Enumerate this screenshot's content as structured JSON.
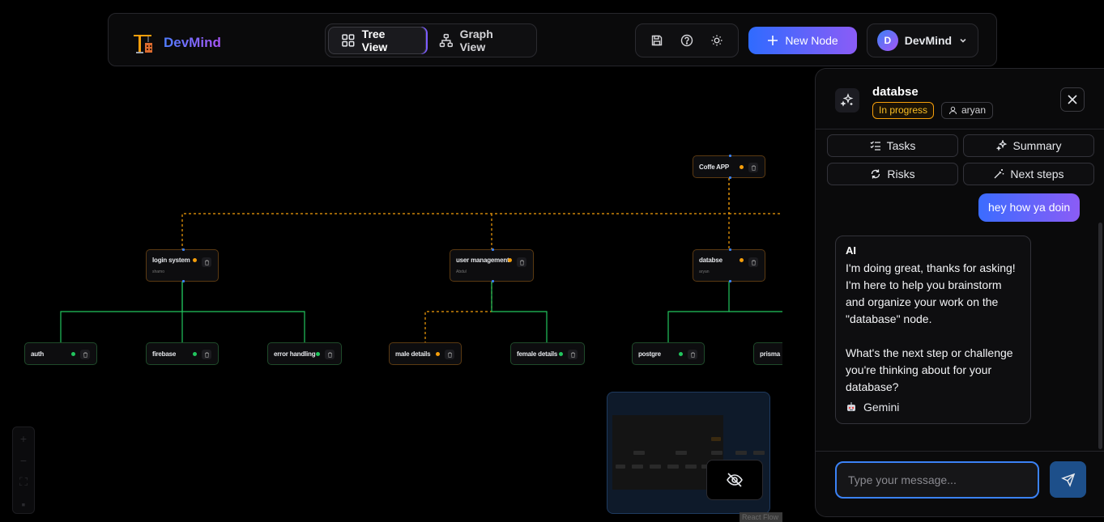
{
  "header": {
    "app_name": "DevMind",
    "views": [
      {
        "label": "Tree View",
        "active": true
      },
      {
        "label": "Graph View",
        "active": false
      }
    ],
    "tools": [
      "save-icon",
      "help-icon",
      "theme-sun-icon"
    ],
    "new_node_label": "New Node",
    "user": {
      "initial": "D",
      "name": "DevMind"
    }
  },
  "canvas": {
    "nodes": [
      {
        "id": "coffee",
        "title": "Coffe APP",
        "sub": "",
        "status": "orange"
      },
      {
        "id": "login",
        "title": "login system",
        "sub": "shamo",
        "status": "orange"
      },
      {
        "id": "usermgmt",
        "title": "user management",
        "sub": "Abdul",
        "status": "orange"
      },
      {
        "id": "databse",
        "title": "databse",
        "sub": "aryan",
        "status": "orange"
      },
      {
        "id": "auth",
        "title": "auth",
        "sub": "",
        "status": "green"
      },
      {
        "id": "firebase",
        "title": "firebase",
        "sub": "",
        "status": "green"
      },
      {
        "id": "errh",
        "title": "error handling",
        "sub": "",
        "status": "green"
      },
      {
        "id": "male",
        "title": "male details",
        "sub": "",
        "status": "orange"
      },
      {
        "id": "female",
        "title": "female details",
        "sub": "",
        "status": "green"
      },
      {
        "id": "postgre",
        "title": "postgre",
        "sub": "",
        "status": "green"
      },
      {
        "id": "prisma",
        "title": "prisma",
        "sub": "",
        "status": "green"
      }
    ],
    "attribution": "React Flow",
    "colors": {
      "in_progress": "#f59e0b",
      "done": "#22c55e",
      "handle": "#3b82f6"
    }
  },
  "panel": {
    "title": "databse",
    "status": "In progress",
    "owner": "aryan",
    "actions": [
      {
        "label": "Tasks",
        "icon": "list-check-icon"
      },
      {
        "label": "Summary",
        "icon": "sparkles-icon"
      },
      {
        "label": "Risks",
        "icon": "refresh-icon"
      },
      {
        "label": "Next steps",
        "icon": "magic-wand-icon"
      }
    ],
    "messages": {
      "user": "hey how ya doin",
      "ai_label": "AI",
      "ai_text": "I'm doing great, thanks for asking! I'm here to help you brainstorm and organize your work on the \"database\" node.\n\nWhat's the next step or challenge you're thinking about for your database?",
      "ai_model": "Gemini"
    },
    "input_placeholder": "Type your message..."
  }
}
